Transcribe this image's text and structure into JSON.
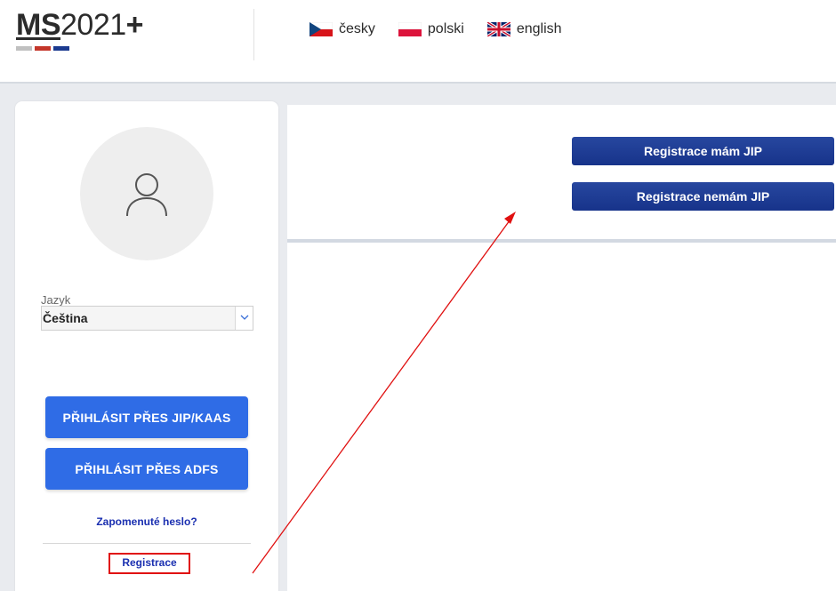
{
  "header": {
    "logo": {
      "ms": "MS",
      "num": "2021",
      "plus": "+"
    },
    "logo_bar_colors": [
      "#c0c0c0",
      "#c4362a",
      "#1b3a8f"
    ],
    "languages": [
      {
        "label": "česky",
        "icon": "czech-flag-icon"
      },
      {
        "label": "polski",
        "icon": "polish-flag-icon"
      },
      {
        "label": "english",
        "icon": "uk-flag-icon"
      }
    ]
  },
  "login": {
    "avatar_icon": "user-icon",
    "language_label": "Jazyk",
    "language_value": "Čeština",
    "login_jip_label": "PŘIHLÁSIT PŘES JIP/KAAS",
    "login_adfs_label": "PŘIHLÁSIT PŘES ADFS",
    "forgot_password": "Zapomenuté heslo?",
    "register_link": "Registrace"
  },
  "registration": {
    "have_jip_label": "Registrace mám JIP",
    "no_jip_label": "Registrace nemám JIP"
  },
  "colors": {
    "primary_blue": "#2f6ce6",
    "dark_blue": "#1c3b94",
    "link_blue": "#1a2fb0",
    "highlight_red": "#e01010"
  }
}
